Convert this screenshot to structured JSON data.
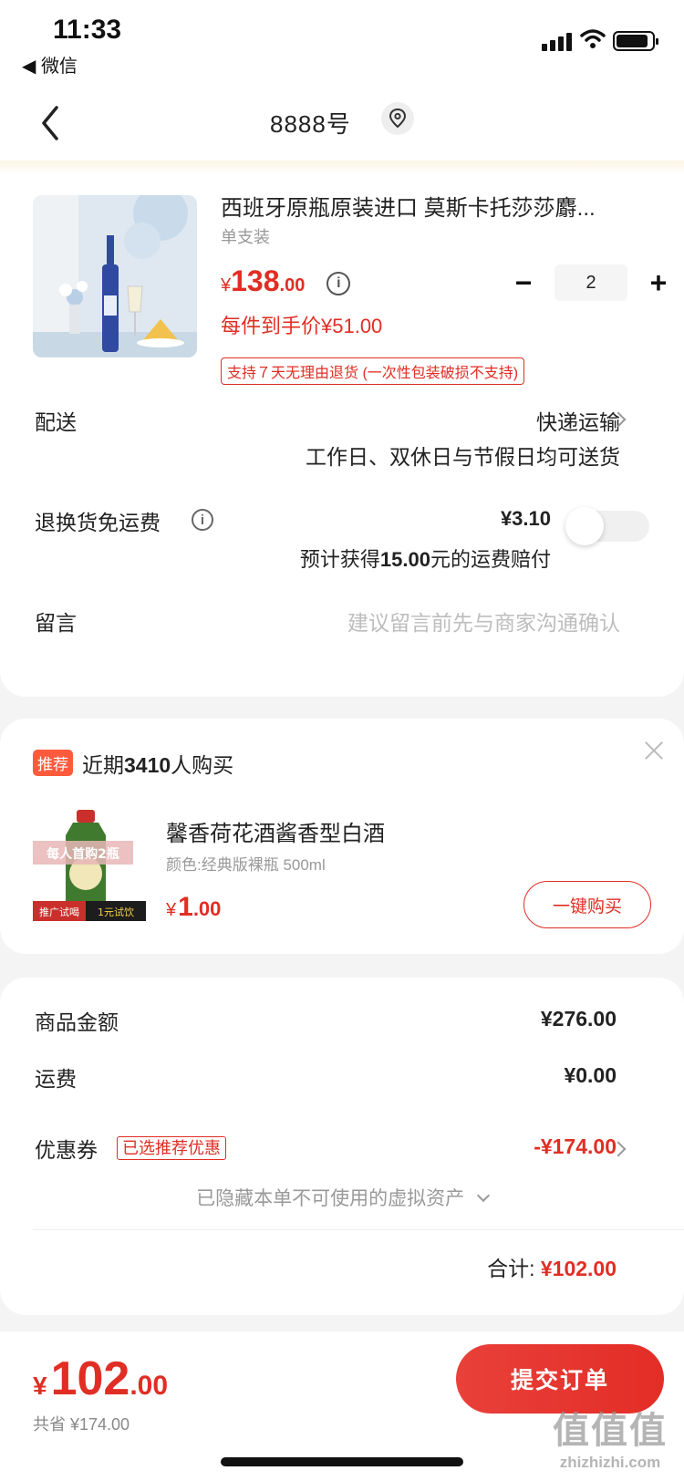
{
  "status_bar": {
    "time": "11:33",
    "back_app": "◀ 微信"
  },
  "nav": {
    "title": "8888号"
  },
  "product": {
    "title": "西班牙原瓶原装进口 莫斯卡托莎莎麝...",
    "spec": "单支装",
    "price_currency": "¥",
    "price_int": "138",
    "price_dec": ".00",
    "quantity": "2",
    "unit_price": "每件到手价¥51.00",
    "policy": "支持７天无理由退货 (一次性包装破损不支持)"
  },
  "delivery": {
    "label": "配送",
    "value": "快递运输",
    "sub": "工作日、双休日与节假日均可送货"
  },
  "return_insurance": {
    "label": "退换货免运费",
    "price": "¥3.10",
    "sub_prefix": "预计获得",
    "sub_amount": "15.00",
    "sub_suffix": "元的运费赔付",
    "toggle_on": false
  },
  "message": {
    "label": "留言",
    "placeholder": "建议留言前先与商家沟通确认"
  },
  "recommend": {
    "badge": "推荐",
    "text_prefix": "近期",
    "count": "3410",
    "text_suffix": "人购买",
    "item_title": "馨香荷花酒酱香型白酒",
    "item_spec": "颜色:经典版裸瓶 500ml",
    "thumb_top_text": "每人首购2瓶",
    "thumb_bottom_left": "推广试喝",
    "thumb_bottom_right": "1元试饮",
    "price_currency": "¥",
    "price_int": "1",
    "price_dec": ".00",
    "buy_label": "一键购买"
  },
  "summary": {
    "goods_label": "商品金额",
    "goods_value": "¥276.00",
    "shipping_label": "运费",
    "shipping_value": "¥0.00",
    "coupon_label": "优惠券",
    "coupon_tag": "已选推荐优惠",
    "coupon_value": "-¥174.00",
    "hidden_assets": "已隐藏本单不可使用的虚拟资产",
    "total_label": "合计: ",
    "total_value": "¥102.00"
  },
  "bottom_bar": {
    "price_currency": "¥",
    "price_int": "102",
    "price_dec": ".00",
    "saved": "共省 ¥174.00",
    "submit_label": "提交订单"
  },
  "watermark": {
    "main": "值值值",
    "sub": "zhizhizhi.com"
  },
  "colors": {
    "accent": "#e02e24",
    "badge": "#ff5a3c",
    "background": "#f4f4f4"
  }
}
